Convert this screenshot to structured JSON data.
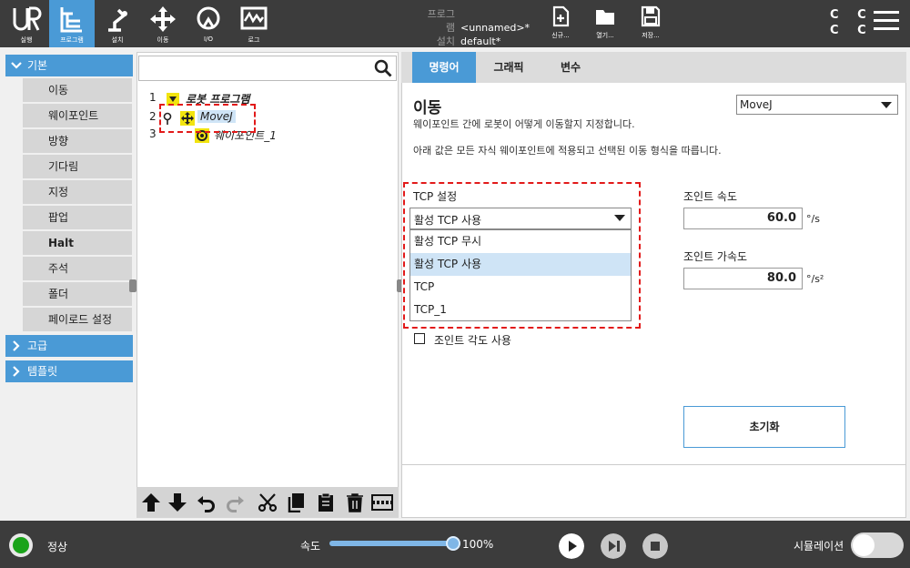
{
  "topnav": {
    "items": [
      {
        "id": "run",
        "label": "실행"
      },
      {
        "id": "program",
        "label": "프로그램"
      },
      {
        "id": "installation",
        "label": "설치"
      },
      {
        "id": "move",
        "label": "이동"
      },
      {
        "id": "io",
        "label": "I/O"
      },
      {
        "id": "log",
        "label": "로그"
      }
    ],
    "program_key": "프로그램",
    "program_value": "<unnamed>*",
    "install_key": "설치",
    "install_value": "default*",
    "file_buttons": [
      {
        "label": "신규..."
      },
      {
        "label": "열기..."
      },
      {
        "label": "저장..."
      }
    ],
    "cc_line1": "C C",
    "cc_line2": "C C"
  },
  "sidebar": {
    "basic_label": "기본",
    "items": [
      "이동",
      "웨이포인트",
      "방향",
      "기다림",
      "지정",
      "팝업",
      "Halt",
      "주석",
      "폴더",
      "페이로드 설정"
    ],
    "advanced_label": "고급",
    "template_label": "템플릿"
  },
  "tree": {
    "search_placeholder": "",
    "rows": [
      {
        "num": "1",
        "label": "로봇 프로그램"
      },
      {
        "num": "2",
        "label": "MoveJ"
      },
      {
        "num": "3",
        "label": "웨이포인트_1"
      }
    ]
  },
  "tabs": [
    "명령어",
    "그래픽",
    "변수"
  ],
  "command": {
    "title": "이동",
    "desc1": "웨이포인트 간에 로봇이 어떻게 이동할지 지정합니다.",
    "desc2": "아래 값은 모든 자식 웨이포인트에 적용되고 선택된 이동 형식을 따릅니다.",
    "move_type": "MoveJ",
    "tcp_label": "TCP 설정",
    "tcp_selected": "활성 TCP 사용",
    "tcp_options": [
      "활성 TCP 무시",
      "활성 TCP 사용",
      "TCP",
      "TCP_1"
    ],
    "tcp_highlight_index": 1,
    "joint_speed_label": "조인트 속도",
    "joint_speed_value": "60.0",
    "joint_speed_unit": "°/s",
    "joint_accel_label": "조인트 가속도",
    "joint_accel_value": "80.0",
    "joint_accel_unit": "°/s²",
    "use_joint_angles_label": "조인트 각도 사용",
    "reset_label": "초기화"
  },
  "bottom": {
    "status_label": "정상",
    "speed_label": "속도",
    "speed_value": "100%",
    "speed_fraction": 1.0,
    "simulation_label": "시뮬레이션"
  },
  "colors": {
    "accent": "#4a9ad6",
    "bar": "#3c3c3c",
    "highlight": "#e21a1a",
    "status_ok": "#1aa31a"
  }
}
